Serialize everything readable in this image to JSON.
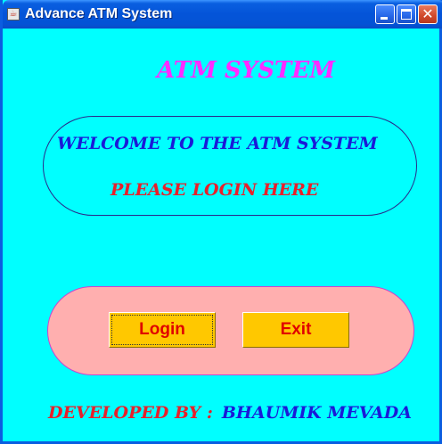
{
  "window": {
    "title": "Advance ATM System",
    "app_icon": "java-cup-icon",
    "background_color": "#00ffff",
    "controls": {
      "minimize_icon": "minimize-icon",
      "maximize_icon": "maximize-icon",
      "close_icon": "close-icon",
      "close_glyph": "✕"
    }
  },
  "main": {
    "heading": "ATM SYSTEM",
    "welcome_text": "WELCOME TO THE ATM SYSTEM",
    "login_hint": "PLEASE LOGIN HERE",
    "buttons": {
      "login_label": "Login",
      "exit_label": "Exit"
    },
    "footer": {
      "developed_by_label": "DEVELOPED BY :",
      "developer_name": "BHAUMIK MEVADA"
    }
  },
  "colors": {
    "heading": "#ff2bff",
    "welcome": "#1a1ad8",
    "hint": "#e8202a",
    "button_bg": "#ffc800",
    "button_text": "#e00000",
    "button_panel": "#ffafaf"
  }
}
